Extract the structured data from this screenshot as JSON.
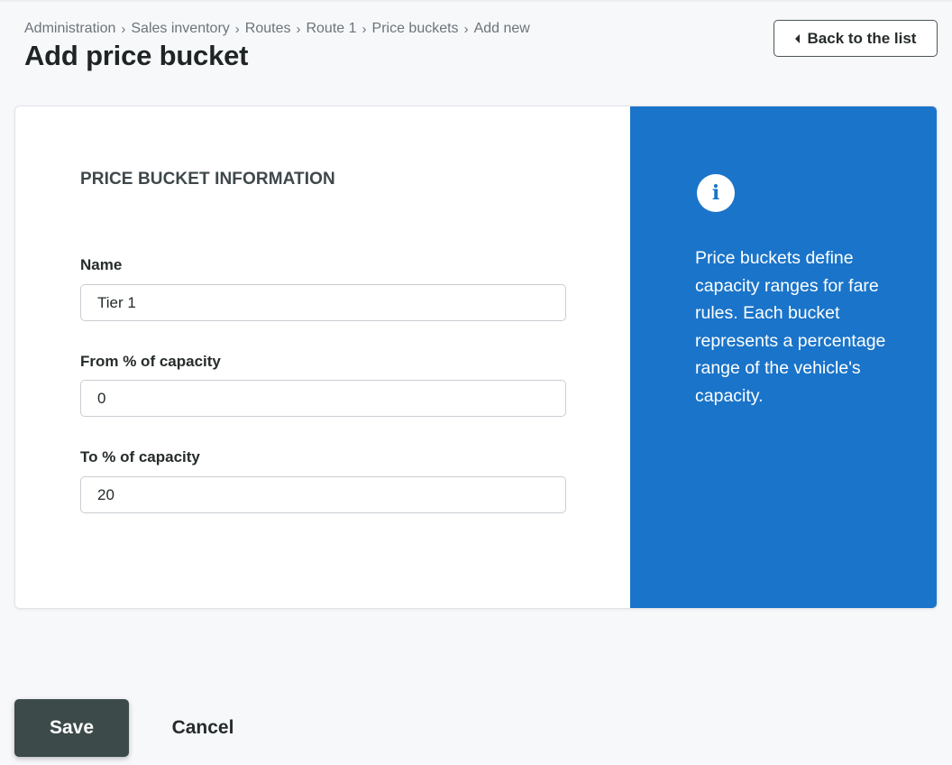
{
  "breadcrumb": {
    "items": [
      "Administration",
      "Sales inventory",
      "Routes",
      "Route 1",
      "Price buckets",
      "Add new"
    ],
    "separator": "›"
  },
  "page": {
    "title": "Add price bucket",
    "back_label": "Back to the list"
  },
  "form": {
    "section_title": "PRICE BUCKET INFORMATION",
    "fields": [
      {
        "label": "Name",
        "value": "Tier 1"
      },
      {
        "label": "From % of capacity",
        "value": "0"
      },
      {
        "label": "To % of capacity",
        "value": "20"
      }
    ]
  },
  "info": {
    "icon": "info-icon",
    "text": "Price buckets define capacity ranges for fare rules. Each bucket represents a percentage range of the vehicle's capacity."
  },
  "actions": {
    "save_label": "Save",
    "cancel_label": "Cancel"
  },
  "colors": {
    "accent": "#1a74c9",
    "primary_button": "#3c4a49",
    "background": "#f7f8fa"
  }
}
